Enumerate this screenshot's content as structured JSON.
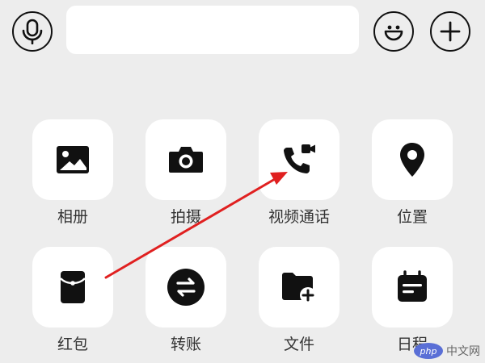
{
  "input_bar": {
    "voice_icon": "microphone-icon",
    "emoji_icon": "smiley-icon",
    "more_icon": "plus-icon"
  },
  "panel": {
    "items": [
      {
        "label": "相册",
        "icon": "photo-album-icon"
      },
      {
        "label": "拍摄",
        "icon": "camera-icon"
      },
      {
        "label": "视频通话",
        "icon": "video-call-icon"
      },
      {
        "label": "位置",
        "icon": "location-pin-icon"
      },
      {
        "label": "红包",
        "icon": "red-packet-icon"
      },
      {
        "label": "转账",
        "icon": "transfer-icon"
      },
      {
        "label": "文件",
        "icon": "folder-add-icon"
      },
      {
        "label": "日程",
        "icon": "calendar-icon"
      }
    ]
  },
  "annotation": {
    "color": "#e02020"
  },
  "watermark": {
    "badge": "php",
    "text": "中文网"
  }
}
